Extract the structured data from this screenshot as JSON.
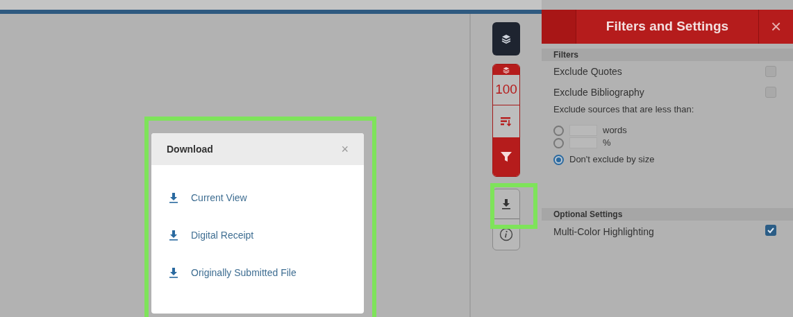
{
  "panel": {
    "title": "Filters and Settings",
    "close": "×"
  },
  "filters": {
    "heading": "Filters",
    "options": [
      {
        "label": "Exclude Quotes",
        "checked": false
      },
      {
        "label": "Exclude Bibliography",
        "checked": false
      }
    ],
    "size_label": "Exclude sources that are less than:",
    "size_options": [
      {
        "kind": "input",
        "unit": "words",
        "selected": false
      },
      {
        "kind": "input",
        "unit": "%",
        "selected": false
      },
      {
        "kind": "plain",
        "label": "Don't exclude by size",
        "selected": true
      }
    ]
  },
  "optional": {
    "heading": "Optional Settings",
    "options": [
      {
        "label": "Multi-Color Highlighting",
        "checked": true
      }
    ]
  },
  "toolbar": {
    "score": "100"
  },
  "download": {
    "title": "Download",
    "close": "×",
    "items": [
      "Current View",
      "Digital Receipt",
      "Originally Submitted File"
    ]
  }
}
